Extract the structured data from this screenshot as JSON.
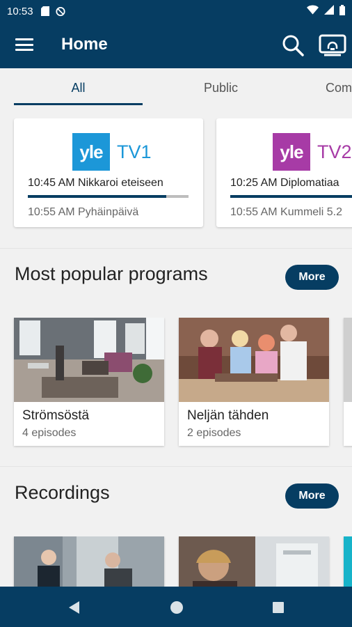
{
  "status_bar": {
    "time": "10:53"
  },
  "app_bar": {
    "title": "Home"
  },
  "tabs": [
    {
      "label": "All",
      "active": true
    },
    {
      "label": "Public",
      "active": false
    },
    {
      "label": "Com",
      "active": false
    }
  ],
  "channels": [
    {
      "badge": "yle",
      "name": "TV1",
      "color": "#1c97d8",
      "now": "10:45 AM Nikkaroi eteiseen",
      "progress": 0.86,
      "next": "10:55 AM Pyhäinpäivä"
    },
    {
      "badge": "yle",
      "name": "TV2",
      "color": "#a73ba6",
      "now": "10:25 AM Diplomatiaa",
      "progress": 1.0,
      "next": "10:55 AM Kummeli 5.2"
    }
  ],
  "popular": {
    "title": "Most popular programs",
    "more_label": "More",
    "items": [
      {
        "title": "Strömsöstä",
        "subtitle": "4 episodes"
      },
      {
        "title": "Neljän tähden",
        "subtitle": "2 episodes"
      }
    ]
  },
  "recordings": {
    "title": "Recordings",
    "more_label": "More"
  },
  "colors": {
    "primary": "#063d62",
    "background": "#f1f1f1"
  }
}
